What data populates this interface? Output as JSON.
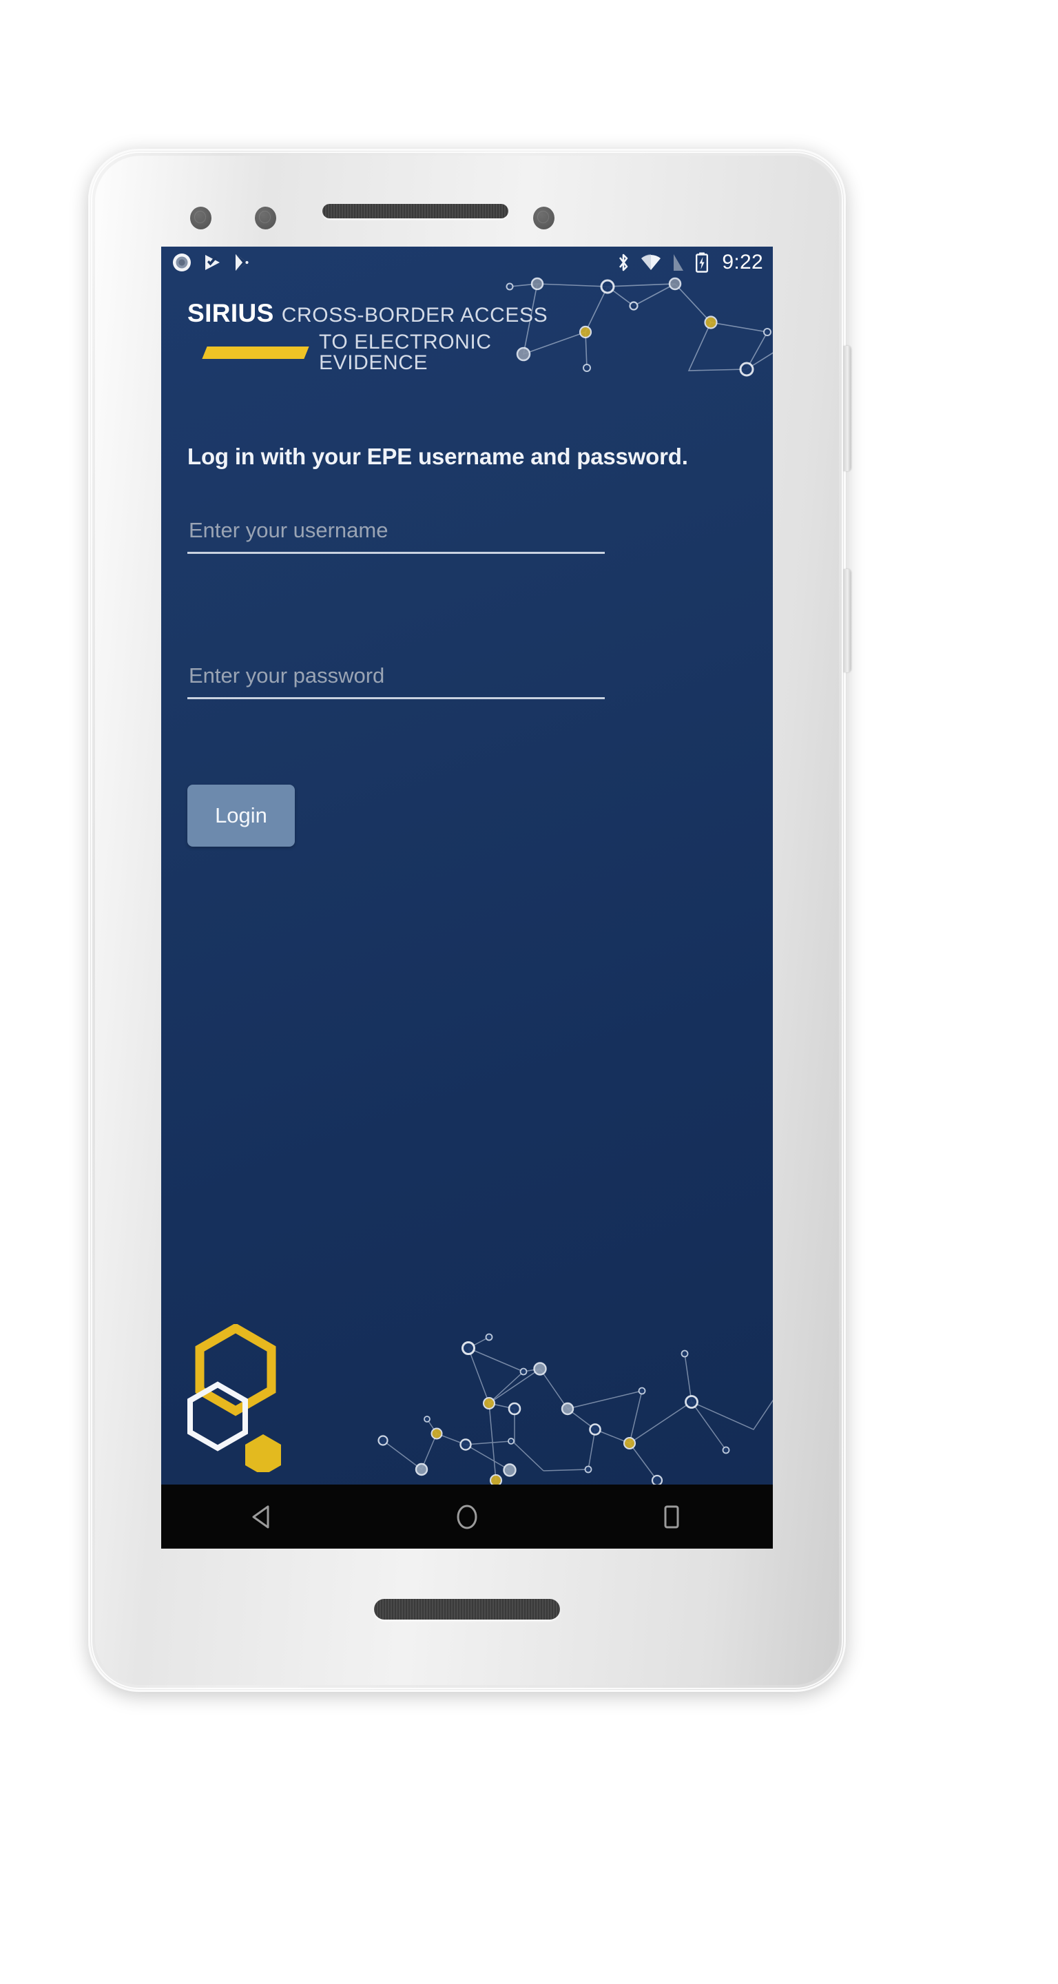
{
  "device": {
    "name": "android-phone-mockup",
    "body_color": "#e8e8e8",
    "screen_bg": "#1b3663"
  },
  "status_bar": {
    "left_icons": [
      {
        "name": "record-circle-icon"
      },
      {
        "name": "play-protect-check-icon"
      },
      {
        "name": "play-store-icon"
      }
    ],
    "right_icons": [
      {
        "name": "bluetooth-icon"
      },
      {
        "name": "wifi-icon"
      },
      {
        "name": "cell-signal-icon"
      },
      {
        "name": "battery-charging-icon"
      }
    ],
    "clock": "9:22"
  },
  "logo": {
    "brand": "SIRIUS",
    "tagline_line1": "CROSS-BORDER  ACCESS",
    "tagline_line2": "TO ELECTRONIC EVIDENCE",
    "accent_color": "#efc325",
    "text_color": "#d5dce8"
  },
  "login": {
    "heading": "Log in with your EPE username and password.",
    "username": {
      "value": "",
      "placeholder": "Enter your username"
    },
    "password": {
      "value": "",
      "placeholder": "Enter your password"
    },
    "submit_label": "Login",
    "submit_color": "#6d8aad"
  },
  "decoration": {
    "hexagons": [
      {
        "name": "hexagon-large-outline",
        "color": "#efc325",
        "filled": false
      },
      {
        "name": "hexagon-small-outline",
        "color": "#ffffff",
        "filled": false
      },
      {
        "name": "hexagon-filled",
        "color": "#e3ba1f",
        "filled": true
      }
    ],
    "network_node_colors": {
      "node": "#c9d4e4",
      "highlight": "#d2b02a"
    }
  },
  "nav_bar": {
    "items": [
      {
        "name": "nav-back-button",
        "icon": "triangle-left-icon"
      },
      {
        "name": "nav-home-button",
        "icon": "circle-icon"
      },
      {
        "name": "nav-recents-button",
        "icon": "square-icon"
      }
    ]
  }
}
